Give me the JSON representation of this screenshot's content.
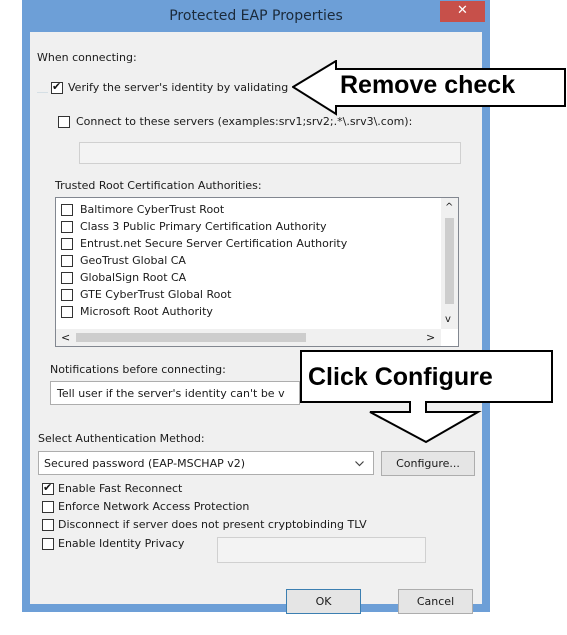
{
  "dialog": {
    "title": "Protected EAP Properties",
    "close_glyph": "✕"
  },
  "connecting": {
    "label": "When connecting:",
    "verify": {
      "label": "Verify the server's identity by validating",
      "checked": true
    },
    "connect_servers": {
      "label": "Connect to these servers (examples:srv1;srv2;.*\\.srv3\\.com):",
      "checked": false
    },
    "servers_value": ""
  },
  "trusted_ca": {
    "label": "Trusted Root Certification Authorities:",
    "items": [
      {
        "label": "Baltimore CyberTrust Root",
        "checked": false
      },
      {
        "label": "Class 3 Public Primary Certification Authority",
        "checked": false
      },
      {
        "label": "Entrust.net Secure Server Certification Authority",
        "checked": false
      },
      {
        "label": "GeoTrust Global CA",
        "checked": false
      },
      {
        "label": "GlobalSign Root CA",
        "checked": false
      },
      {
        "label": "GTE CyberTrust Global Root",
        "checked": false
      },
      {
        "label": "Microsoft Root Authority",
        "checked": false
      }
    ],
    "scroll_up": "^",
    "scroll_down": "v",
    "scroll_left": "<",
    "scroll_right": ">"
  },
  "notifications": {
    "label": "Notifications before connecting:",
    "value": "Tell user if the server's identity can't be v"
  },
  "auth": {
    "label": "Select Authentication Method:",
    "method": "Secured password (EAP-MSCHAP v2)",
    "configure_label": "Configure..."
  },
  "options": [
    {
      "label": "Enable Fast Reconnect",
      "checked": true
    },
    {
      "label": "Enforce Network Access Protection",
      "checked": false
    },
    {
      "label": "Disconnect if server does not present cryptobinding TLV",
      "checked": false
    },
    {
      "label": "Enable Identity Privacy",
      "checked": false
    }
  ],
  "buttons": {
    "ok": "OK",
    "cancel": "Cancel"
  },
  "annotations": {
    "remove_check": "Remove check",
    "click_configure": "Click Configure"
  },
  "colors": {
    "window_frame": "#6d9fd7",
    "close_button": "#c7504a",
    "client_bg": "#f0f0f0"
  }
}
